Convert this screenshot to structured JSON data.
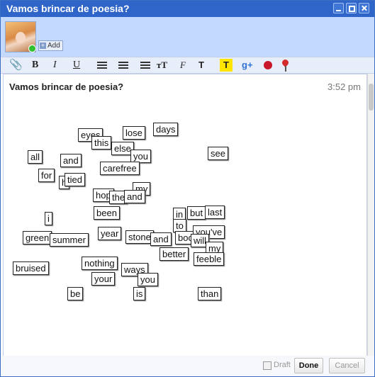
{
  "window": {
    "title": "Vamos brincar de poesia?"
  },
  "profile": {
    "add_label": "Add"
  },
  "toolbar": {
    "icons": [
      "attach-icon",
      "bold-icon",
      "italic-icon",
      "underline-icon",
      "indent-icon",
      "outdent-icon",
      "list-icon",
      "font-size-icon",
      "font-icon",
      "text-color-icon",
      "highlight-icon",
      "google-plus-icon",
      "bug-icon",
      "map-pin-icon"
    ],
    "bold_label": "B",
    "italic_label": "I",
    "underline_label": "U",
    "font_size_label": "тT",
    "font_label": "F",
    "text_color_label": "T",
    "highlight_label": "T",
    "gplus_label": "g+"
  },
  "message": {
    "subject": "Vamos brincar de poesia?",
    "time": "3:52 pm"
  },
  "words": [
    {
      "text": "eyes"
    },
    {
      "text": "lose"
    },
    {
      "text": "days"
    },
    {
      "text": "this"
    },
    {
      "text": "else"
    },
    {
      "text": "you"
    },
    {
      "text": "see"
    },
    {
      "text": "all"
    },
    {
      "text": "and"
    },
    {
      "text": "carefree"
    },
    {
      "text": "for"
    },
    {
      "text": "h"
    },
    {
      "text": "tied"
    },
    {
      "text": "my"
    },
    {
      "text": "hop"
    },
    {
      "text": "the"
    },
    {
      "text": "and"
    },
    {
      "text": "been"
    },
    {
      "text": "in"
    },
    {
      "text": "but"
    },
    {
      "text": "last"
    },
    {
      "text": "i"
    },
    {
      "text": "to"
    },
    {
      "text": "year"
    },
    {
      "text": "stone"
    },
    {
      "text": "and"
    },
    {
      "text": "boo"
    },
    {
      "text": "you've"
    },
    {
      "text": "green"
    },
    {
      "text": "summer"
    },
    {
      "text": "will"
    },
    {
      "text": "my"
    },
    {
      "text": "better"
    },
    {
      "text": "nothing"
    },
    {
      "text": "feeble"
    },
    {
      "text": "bruised"
    },
    {
      "text": "ways"
    },
    {
      "text": "your"
    },
    {
      "text": "you"
    },
    {
      "text": "be"
    },
    {
      "text": "is"
    },
    {
      "text": "than"
    }
  ],
  "footer": {
    "draft_label": "Draft",
    "done_label": "Done",
    "cancel_label": "Cancel"
  },
  "colors": {
    "title_bar": "#2f65c9",
    "profile_bg": "#c3d9ff",
    "toolbar_bg": "#e8eef9",
    "highlight": "#ffe500"
  }
}
